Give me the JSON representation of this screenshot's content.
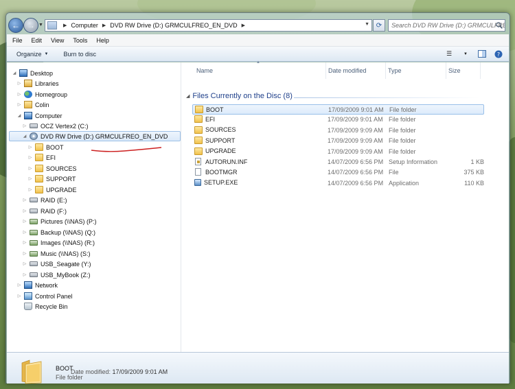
{
  "address": {
    "crumbs": [
      "Computer",
      "DVD RW Drive (D:) GRMCULFREO_EN_DVD"
    ],
    "search_placeholder": "Search DVD RW Drive (D:) GRMCULFREO_EN_DVD"
  },
  "menubar": [
    "File",
    "Edit",
    "View",
    "Tools",
    "Help"
  ],
  "commandbar": {
    "organize": "Organize",
    "burn": "Burn to disc"
  },
  "navpane": {
    "items": [
      {
        "label": "Desktop",
        "icon": "desktop-icon"
      },
      {
        "label": "Libraries",
        "icon": "libraries-icon"
      },
      {
        "label": "Homegroup",
        "icon": "homegroup-icon"
      },
      {
        "label": "Colin",
        "icon": "user-folder-icon"
      },
      {
        "label": "Computer",
        "icon": "computer-icon"
      },
      {
        "label": "OCZ Vertex2 (C:)",
        "icon": "drive-icon"
      },
      {
        "label": "DVD RW Drive (D:) GRMCULFREO_EN_DVD",
        "icon": "dvd-drive-icon"
      },
      {
        "label": "BOOT",
        "icon": "folder-icon"
      },
      {
        "label": "EFI",
        "icon": "folder-icon"
      },
      {
        "label": "SOURCES",
        "icon": "folder-icon"
      },
      {
        "label": "SUPPORT",
        "icon": "folder-icon"
      },
      {
        "label": "UPGRADE",
        "icon": "folder-icon"
      },
      {
        "label": "RAID (E:)",
        "icon": "drive-icon"
      },
      {
        "label": "RAID (F:)",
        "icon": "drive-icon"
      },
      {
        "label": "Pictures (\\\\NAS) (P:)",
        "icon": "network-drive-icon"
      },
      {
        "label": "Backup (\\\\NAS) (Q:)",
        "icon": "network-drive-icon"
      },
      {
        "label": "Images (\\\\NAS) (R:)",
        "icon": "network-drive-icon"
      },
      {
        "label": "Music (\\\\NAS) (S:)",
        "icon": "network-drive-icon"
      },
      {
        "label": "USB_Seagate (Y:)",
        "icon": "drive-icon"
      },
      {
        "label": "USB_MyBook (Z:)",
        "icon": "drive-icon"
      },
      {
        "label": "Network",
        "icon": "network-icon"
      },
      {
        "label": "Control Panel",
        "icon": "control-panel-icon"
      },
      {
        "label": "Recycle Bin",
        "icon": "recycle-bin-icon"
      }
    ]
  },
  "columns": {
    "name": "Name",
    "date": "Date modified",
    "type": "Type",
    "size": "Size"
  },
  "group_header": "Files Currently on the Disc (8)",
  "files": [
    {
      "name": "BOOT",
      "date": "17/09/2009 9:01 AM",
      "type": "File folder",
      "size": "",
      "icon": "folder-icon"
    },
    {
      "name": "EFI",
      "date": "17/09/2009 9:01 AM",
      "type": "File folder",
      "size": "",
      "icon": "folder-icon"
    },
    {
      "name": "SOURCES",
      "date": "17/09/2009 9:09 AM",
      "type": "File folder",
      "size": "",
      "icon": "folder-icon"
    },
    {
      "name": "SUPPORT",
      "date": "17/09/2009 9:09 AM",
      "type": "File folder",
      "size": "",
      "icon": "folder-icon"
    },
    {
      "name": "UPGRADE",
      "date": "17/09/2009 9:09 AM",
      "type": "File folder",
      "size": "",
      "icon": "folder-icon"
    },
    {
      "name": "AUTORUN.INF",
      "date": "14/07/2009 6:56 PM",
      "type": "Setup Information",
      "size": "1 KB",
      "icon": "inf-file-icon"
    },
    {
      "name": "BOOTMGR",
      "date": "14/07/2009 6:56 PM",
      "type": "File",
      "size": "375 KB",
      "icon": "file-icon"
    },
    {
      "name": "SETUP.EXE",
      "date": "14/07/2009 6:56 PM",
      "type": "Application",
      "size": "110 KB",
      "icon": "setup-exe-icon"
    }
  ],
  "details": {
    "name": "BOOT",
    "type": "File folder",
    "date_label": "Date modified:",
    "date_value": "17/09/2009 9:01 AM"
  },
  "colors": {
    "group_header": "#1e3f8a",
    "selection": "#dcebfb",
    "annotation": "#cc1f1f"
  }
}
